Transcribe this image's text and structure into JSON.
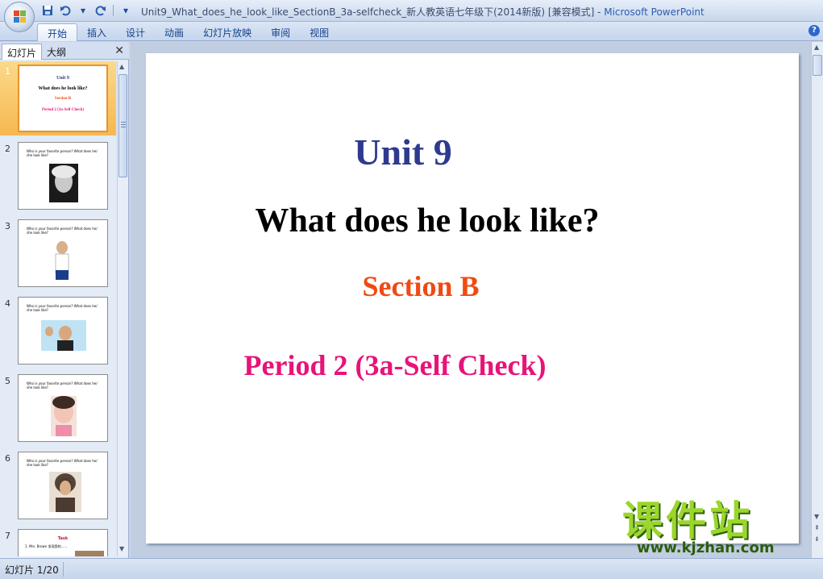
{
  "window": {
    "title": "Unit9_What_does_he_look_like_SectionB_3a-selfcheck_新人教英语七年级下(2014新版) [兼容模式] - ",
    "app_name": "Microsoft PowerPoint"
  },
  "ribbon": {
    "tabs": [
      "开始",
      "插入",
      "设计",
      "动画",
      "幻灯片放映",
      "审阅",
      "视图"
    ],
    "active_tab": "开始"
  },
  "left_panel": {
    "tab_slides": "幻灯片",
    "tab_outline": "大纲",
    "thumbnails": [
      {
        "num": "1",
        "line1": "Unit 9",
        "line2": "What does he look like?",
        "line3": "Section B",
        "line4": "Period 2 (3a-Self Check)"
      },
      {
        "num": "2",
        "text": "Who is your favorite person? What does he/ she look like?"
      },
      {
        "num": "3",
        "text": "Who is your favorite person? What does he/ she look like?"
      },
      {
        "num": "4",
        "text": "Who is your favorite person? What does he/ she look like?"
      },
      {
        "num": "5",
        "text": "Who is your favorite person? What does he/ she look like?"
      },
      {
        "num": "6",
        "text": "Who is your favorite person? What does he/ she look like?"
      },
      {
        "num": "7",
        "title": "Task",
        "text": "1. Mrs. Brown 发现我的......"
      }
    ]
  },
  "slide": {
    "unit": "Unit 9",
    "question": "What does he look like?",
    "section": "Section B",
    "period": "Period 2 (3a-Self Check)"
  },
  "watermark": {
    "chars": "课件站",
    "url": "www.kjzhan.com"
  },
  "status": {
    "slide_counter": "幻灯片 1/20"
  },
  "colors": {
    "unit": "#2e3a8e",
    "section": "#f04a14",
    "period": "#e8137a",
    "selected_thumb": "#f6b850"
  }
}
